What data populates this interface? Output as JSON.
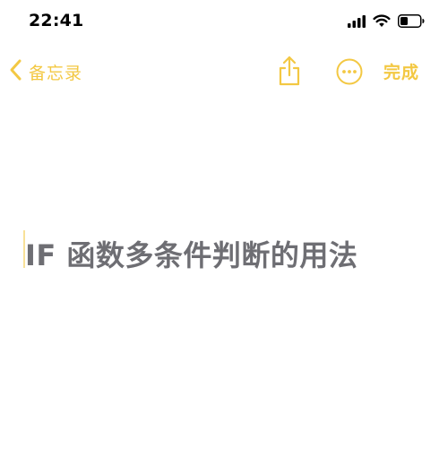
{
  "status_bar": {
    "time": "22:41",
    "icons": [
      "cellular-signal-icon",
      "wifi-icon",
      "battery-icon"
    ]
  },
  "nav": {
    "back_label": "备忘录",
    "done_label": "完成",
    "icons": [
      "chevron-left-icon",
      "share-icon",
      "more-icon"
    ]
  },
  "note": {
    "title": "IF 函数多条件判断的用法"
  },
  "colors": {
    "accent": "#f3c843",
    "title_text": "#6e6e73",
    "status_text": "#000000",
    "background": "#ffffff"
  }
}
